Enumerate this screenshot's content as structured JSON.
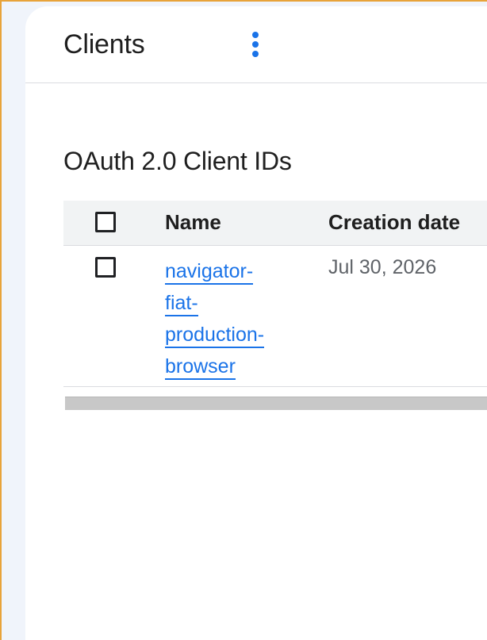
{
  "page": {
    "title": "Clients",
    "menu_icon": "more-vert-icon"
  },
  "colors": {
    "accent": "#1a73e8",
    "window_border": "#e8a33a",
    "header_background": "#f1f3f4"
  },
  "section": {
    "title": "OAuth 2.0 Client IDs"
  },
  "table": {
    "columns": [
      {
        "label": "Name"
      },
      {
        "label": "Creation date",
        "sort_icon": "sort-arrow-icon"
      }
    ],
    "rows": [
      {
        "name_lines": [
          "navigator-",
          "fiat-",
          "production-",
          "browser"
        ],
        "creation_date": "Jul 30, 2026",
        "selected": false
      }
    ]
  }
}
